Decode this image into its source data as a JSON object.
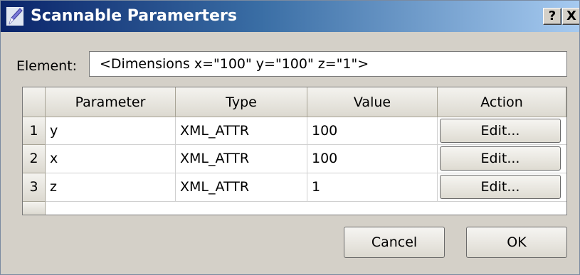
{
  "window": {
    "title": "Scannable Paramerters",
    "help_label": "?",
    "close_label": "X"
  },
  "element": {
    "label": "Element:",
    "value": "<Dimensions  x=\"100\" y=\"100\" z=\"1\">"
  },
  "table": {
    "columns": [
      "Parameter",
      "Type",
      "Value",
      "Action"
    ],
    "rows": [
      {
        "num": "1",
        "parameter": "y",
        "type": "XML_ATTR",
        "value": "100",
        "action": "Edit..."
      },
      {
        "num": "2",
        "parameter": "x",
        "type": "XML_ATTR",
        "value": "100",
        "action": "Edit..."
      },
      {
        "num": "3",
        "parameter": "z",
        "type": "XML_ATTR",
        "value": "1",
        "action": "Edit..."
      }
    ]
  },
  "buttons": {
    "cancel": "Cancel",
    "ok": "OK"
  },
  "colors": {
    "titlebar_start": "#0a246a",
    "titlebar_end": "#a6caf0",
    "dialog_bg": "#d4d0c8"
  },
  "icons": {
    "title_icon": "app-pen-icon"
  }
}
